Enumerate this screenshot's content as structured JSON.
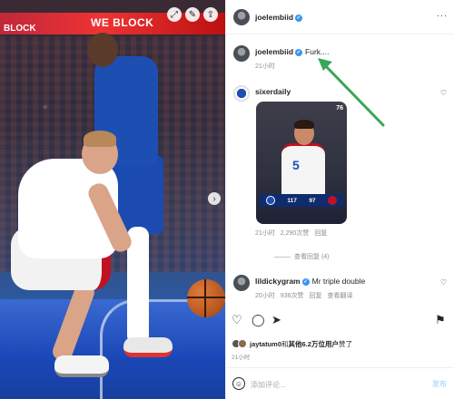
{
  "photo": {
    "banner_text": "WE BLOCK",
    "banner_text_left": "BLOCK",
    "top_buttons": [
      "expand-icon",
      "edit-icon",
      "share-icon"
    ],
    "next_icon": "chevron-right-icon"
  },
  "header": {
    "username": "joelembiid",
    "more": "···"
  },
  "caption": {
    "username": "joelembiid",
    "text": "Furk....",
    "time": "21小时"
  },
  "comments": [
    {
      "username": "sixerdaily",
      "media": {
        "corner_label": "76",
        "jersey_number": "5",
        "score_left": "117",
        "score_right": "97"
      },
      "time": "21小时",
      "likes": "2,290次赞",
      "reply": "回复",
      "view_replies": "查看回复 (4)"
    },
    {
      "username": "lildickygram",
      "text": "Mr triple double",
      "time": "20小时",
      "likes": "936次赞",
      "reply": "回复",
      "translate": "查看翻译"
    }
  ],
  "actions": {
    "like_icon": "heart-icon",
    "comment_icon": "comment-icon",
    "share_icon": "send-icon",
    "save_icon": "bookmark-icon"
  },
  "likes": {
    "user": "jaytatum0",
    "connector": "和",
    "others": "其他6.2万位用户",
    "suffix": "赞了"
  },
  "post_time": "21小时",
  "comment_box": {
    "placeholder": "添加评论...",
    "post_label": "发布"
  },
  "colors": {
    "verified": "#3897f0",
    "arrow": "#3ba65a",
    "link_muted": "#8e8e8e"
  }
}
